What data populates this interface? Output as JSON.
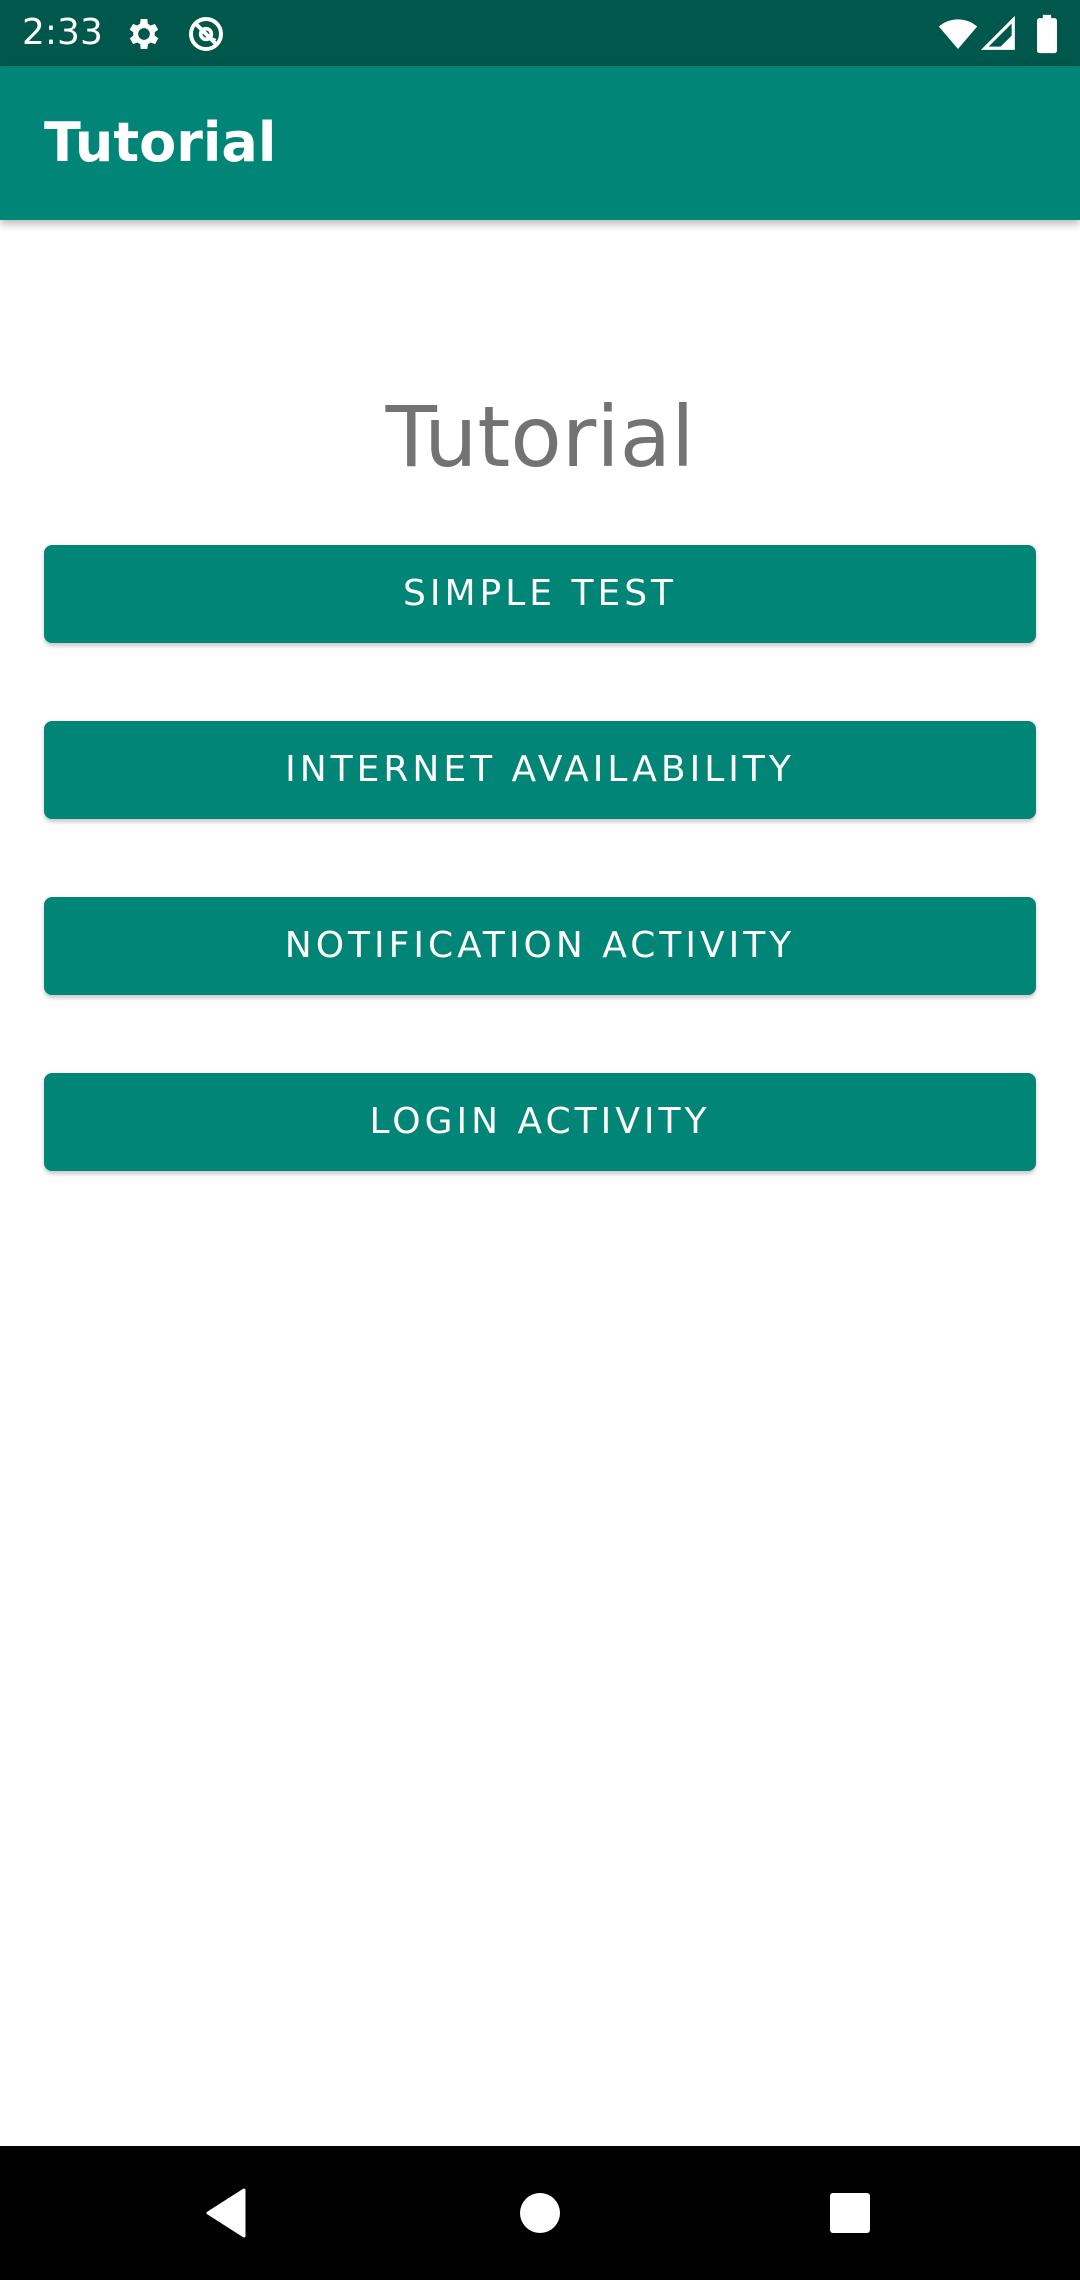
{
  "status_bar": {
    "time": "2:33",
    "icons_left": [
      "gear-icon",
      "at-sign-icon"
    ],
    "icons_right": [
      "wifi-icon",
      "cellular-signal-icon",
      "battery-icon"
    ]
  },
  "app_bar": {
    "title": "Tutorial"
  },
  "main": {
    "heading": "Tutorial",
    "buttons": [
      {
        "label": "SIMPLE TEST"
      },
      {
        "label": "INTERNET AVAILABILITY"
      },
      {
        "label": "NOTIFICATION ACTIVITY"
      },
      {
        "label": "LOGIN ACTIVITY"
      }
    ]
  },
  "nav_bar": {
    "icons": [
      "back-icon",
      "home-icon",
      "recents-icon"
    ]
  },
  "colors": {
    "primary": "#008577",
    "primary_dark": "#00574b",
    "heading_text": "#737373",
    "button_text": "#ffffff",
    "nav_bar": "#000000"
  }
}
